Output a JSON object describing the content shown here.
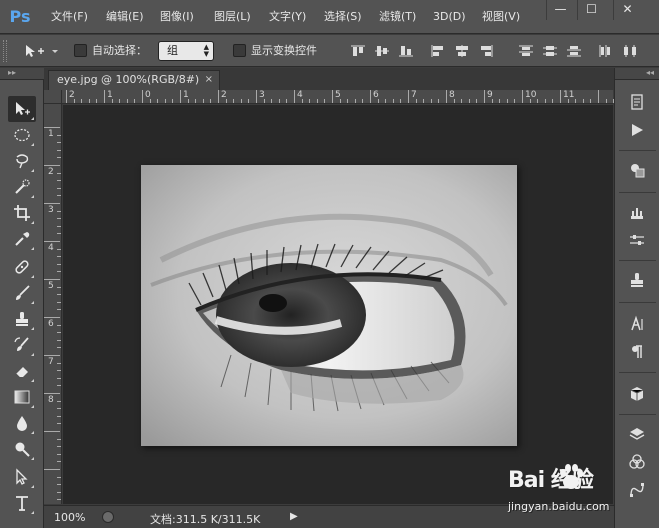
{
  "app": {
    "logo": "Ps"
  },
  "menu": [
    "文件(F)",
    "编辑(E)",
    "图像(I)",
    "图层(L)",
    "文字(Y)",
    "选择(S)",
    "滤镜(T)",
    "3D(D)",
    "视图(V)"
  ],
  "window_controls": [
    "—",
    "☐",
    "✕"
  ],
  "options": {
    "auto_select_label": "自动选择：",
    "auto_select_value": "组",
    "show_transform_label": "显示变换控件"
  },
  "tab": {
    "title": "eye.jpg @ 100%(RGB/8#)",
    "close": "×"
  },
  "ruler_h": [
    "2",
    "1",
    "0",
    "1",
    "2",
    "3",
    "4",
    "5",
    "6",
    "7",
    "8",
    "9",
    "10",
    "11"
  ],
  "ruler_v": [
    "1",
    "2",
    "3",
    "4",
    "5",
    "6",
    "7",
    "8"
  ],
  "status": {
    "zoom": "100%",
    "doc_info": "文档:311.5 K/311.5K",
    "arrow": "▶"
  },
  "watermark": {
    "logo": "Bai   经验",
    "url": "jingyan.baidu.com"
  },
  "colors": {
    "accent": "#5aa6ee",
    "panel": "#535353",
    "canvas": "#282828"
  }
}
